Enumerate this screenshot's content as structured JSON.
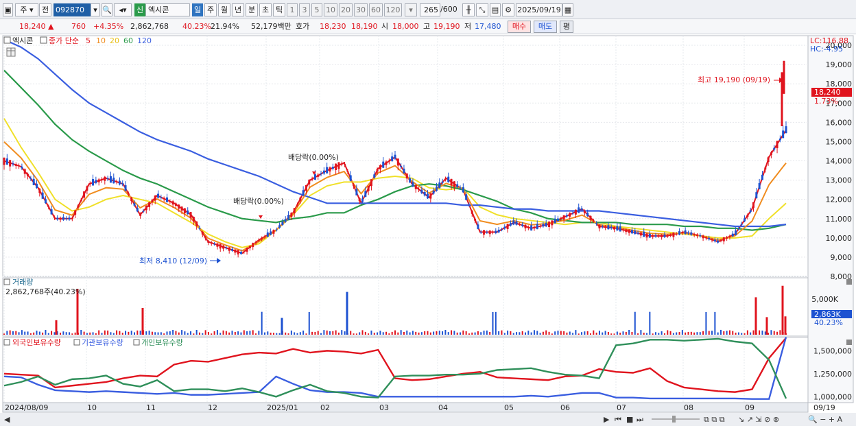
{
  "toolbar": {
    "period_label": "주",
    "prev_label": "전",
    "code": "092870",
    "badge": "신",
    "name": "엑시콘",
    "tf_day": "일",
    "tf_week": "주",
    "tf_month": "월",
    "tf_year": "년",
    "tf_min": "분",
    "tf_sec": "초",
    "tf_tick": "틱",
    "n1": "1",
    "n3": "3",
    "n5": "5",
    "n10": "10",
    "n20": "20",
    "n30": "30",
    "n60": "60",
    "n120": "120",
    "count": "265",
    "count_total": "/600",
    "date": "2025/09/19"
  },
  "quote": {
    "price": "18,240",
    "change": "760",
    "change_pct": "+4.35%",
    "volume": "2,862,768",
    "vol_ratio": "40.23%",
    "turnover": "21.94%",
    "amount": "52,179백만",
    "ask_label": "호가",
    "ask1": "18,230",
    "ask2": "18,190",
    "open_label": "시",
    "open": "18,000",
    "high_label": "고",
    "high": "19,190",
    "low_label": "저",
    "low": "17,480",
    "buy_label": "매수",
    "sell_label": "매도",
    "eval_label": "평"
  },
  "legend": {
    "name": "엑시콘",
    "title": "종가 단순",
    "ma5": "5",
    "ma10": "10",
    "ma20": "20",
    "ma60": "60",
    "ma120": "120"
  },
  "corner": {
    "lc": "LC:116.88",
    "hc": "HC:-4.95"
  },
  "annotations": {
    "max": "최고 19,190 (09/19)",
    "min": "최저 8,410 (12/09)",
    "div1": "배당락(0.00%)",
    "div2": "배당락(0.00%)"
  },
  "price_tag": {
    "value": "18,240",
    "pct": "1.73%"
  },
  "volume_panel": {
    "title": "거래량",
    "value": "2,862,768주(40.23%)",
    "tag_value": "2,863K",
    "tag_pct": "40.23%"
  },
  "holding_panel": {
    "series1": "외국인보유수량",
    "series2": "기관보유수량",
    "series3": "개인보유수량"
  },
  "colors": {
    "up": "#e0141e",
    "down": "#1d52d1",
    "ma5": "#e0141e",
    "ma10": "#f08c1e",
    "ma20": "#f0e02a",
    "ma60": "#2a9a4a",
    "ma120": "#3a5ee0",
    "foreign": "#e0141e",
    "inst": "#3a5ee0",
    "indiv": "#2f8f5a"
  },
  "chart_data": [
    {
      "type": "candlestick",
      "title": "",
      "ylim": [
        8000,
        20500
      ],
      "yticks": [
        "20,000",
        "19,000",
        "18,000",
        "17,000",
        "16,000",
        "15,000",
        "14,000",
        "13,000",
        "12,000",
        "11,000",
        "10,000",
        "9,000",
        "8,000"
      ],
      "xticks": [
        "2024/08/09",
        "10",
        "11",
        "12",
        "2025/01",
        "02",
        "03",
        "04",
        "05",
        "06",
        "07",
        "08",
        "09"
      ],
      "x_last": "09/19",
      "series": [
        {
          "name": "MA5",
          "values": [
            14000,
            13700,
            12600,
            11000,
            11000,
            12800,
            13100,
            12800,
            11200,
            12200,
            11800,
            11200,
            9800,
            9500,
            9200,
            9900,
            10400,
            11300,
            13000,
            13500,
            13900,
            11800,
            13600,
            14200,
            12800,
            12100,
            13100,
            12500,
            10300,
            10300,
            10800,
            10500,
            10700,
            11100,
            11500,
            10600,
            10500,
            10300,
            10100,
            10100,
            10300,
            10100,
            9800,
            10200,
            11500,
            14200,
            15600
          ]
        },
        {
          "name": "MA20",
          "values": [
            16200,
            14700,
            13400,
            12000,
            11400,
            11600,
            12000,
            12200,
            12000,
            11800,
            11300,
            10800,
            10200,
            9800,
            9500,
            9700,
            10400,
            11200,
            12200,
            12700,
            12900,
            12900,
            13100,
            13200,
            13100,
            12600,
            12500,
            12600,
            11600,
            11200,
            11000,
            10900,
            10800,
            10700,
            10800,
            10800,
            10600,
            10500,
            10400,
            10300,
            10200,
            10100,
            10000,
            10000,
            10100,
            11000,
            11800
          ]
        },
        {
          "name": "MA60",
          "values": [
            18700,
            17800,
            16900,
            15900,
            15100,
            14500,
            14000,
            13500,
            13100,
            12800,
            12400,
            12000,
            11600,
            11300,
            11000,
            10900,
            10800,
            11000,
            11100,
            11300,
            11300,
            11700,
            12000,
            12400,
            12700,
            12800,
            12700,
            12500,
            12200,
            11900,
            11500,
            11300,
            11000,
            10900,
            10800,
            10800,
            10800,
            10700,
            10700,
            10700,
            10600,
            10600,
            10500,
            10500,
            10400,
            10500,
            10700
          ]
        },
        {
          "name": "MA120",
          "values": [
            20300,
            19900,
            19300,
            18500,
            17700,
            17000,
            16500,
            16000,
            15500,
            15100,
            14800,
            14500,
            14100,
            13800,
            13500,
            13200,
            12800,
            12400,
            12100,
            11800,
            11800,
            11800,
            11800,
            11800,
            11800,
            11800,
            11800,
            11700,
            11700,
            11600,
            11500,
            11500,
            11400,
            11400,
            11400,
            11400,
            11300,
            11200,
            11100,
            11000,
            10900,
            10800,
            10700,
            10600,
            10600,
            10600,
            10700
          ]
        }
      ],
      "annotations": {
        "high": 19190,
        "low": 8410,
        "last": 18240
      }
    },
    {
      "type": "bar",
      "title": "거래량",
      "yticks": [
        "5,000K"
      ],
      "ylim": [
        0,
        7000
      ]
    },
    {
      "type": "line",
      "title": "보유수량",
      "yticks": [
        "1,500,000",
        "1,250,000",
        "1,000,000"
      ],
      "ylim": [
        950000,
        1600000
      ],
      "series": [
        {
          "name": "외국인보유수량",
          "values": [
            1250000,
            1240000,
            1230000,
            1100000,
            1120000,
            1140000,
            1160000,
            1200000,
            1230000,
            1220000,
            1350000,
            1390000,
            1380000,
            1420000,
            1460000,
            1480000,
            1470000,
            1520000,
            1480000,
            1500000,
            1490000,
            1470000,
            1510000,
            1200000,
            1180000,
            1190000,
            1220000,
            1250000,
            1270000,
            1210000,
            1200000,
            1190000,
            1180000,
            1220000,
            1230000,
            1300000,
            1270000,
            1260000,
            1310000,
            1170000,
            1100000,
            1080000,
            1060000,
            1050000,
            1080000,
            1420000,
            1640000
          ]
        },
        {
          "name": "기관보유수량",
          "values": [
            1220000,
            1210000,
            1130000,
            1070000,
            1060000,
            1050000,
            1060000,
            1050000,
            1040000,
            1030000,
            1040000,
            1020000,
            1020000,
            1030000,
            1040000,
            1050000,
            1220000,
            1140000,
            1070000,
            1050000,
            1050000,
            1040000,
            1000000,
            1000000,
            1000000,
            1000000,
            1000000,
            1000000,
            1000000,
            1000000,
            1000000,
            1010000,
            1000000,
            1020000,
            1040000,
            1040000,
            990000,
            990000,
            980000,
            980000,
            980000,
            980000,
            980000,
            980000,
            975000,
            975000,
            1650000
          ]
        },
        {
          "name": "개인보유수량",
          "values": [
            1120000,
            1160000,
            1220000,
            1130000,
            1190000,
            1200000,
            1230000,
            1140000,
            1110000,
            1180000,
            1060000,
            1080000,
            1080000,
            1060000,
            1090000,
            1050000,
            1000000,
            1070000,
            1130000,
            1060000,
            1040000,
            1000000,
            990000,
            1220000,
            1230000,
            1230000,
            1240000,
            1240000,
            1250000,
            1290000,
            1300000,
            1310000,
            1270000,
            1240000,
            1230000,
            1200000,
            1560000,
            1580000,
            1620000,
            1620000,
            1610000,
            1620000,
            1630000,
            1600000,
            1580000,
            1400000,
            980000
          ]
        }
      ]
    }
  ]
}
